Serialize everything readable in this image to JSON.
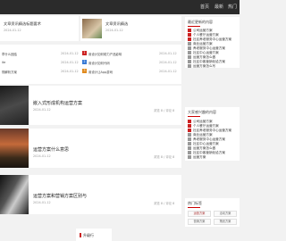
{
  "topnav": {
    "item1": "首页",
    "item2": "最新",
    "item3": "热门"
  },
  "featured": {
    "left": {
      "title": "文章资讯精选标题要术",
      "date": "2024-01-12"
    },
    "right": {
      "title": "文章资讯精选",
      "date": "2024-01-12"
    }
  },
  "small_list": {
    "col1": [
      {
        "text": "章什么团结",
        "date": "2024-01-12"
      },
      {
        "text": "ite",
        "date": "2024-01-12"
      },
      {
        "text": "规解析方案",
        "date": "2024-01-12"
      }
    ],
    "col2": [
      {
        "num": "1",
        "text": "用设计如何助力产品影响",
        "date": "2024-01-12"
      },
      {
        "num": "2",
        "text": "用设计如何代码",
        "date": "2024-01-12"
      },
      {
        "num": "3",
        "text": "用设计让App游戏",
        "date": "2024-01-12"
      }
    ]
  },
  "articles": [
    {
      "title": "嵌入式形成机构运营方案",
      "meta": "2024-01-12",
      "meta2": "浏览 8 / 评论 8"
    },
    {
      "title": "运营方案什么意思",
      "meta": "2024-01-12",
      "meta2": "浏览 8 / 评论 8"
    },
    {
      "title": "运营方案和营销方案区别与",
      "meta": "2024-01-12",
      "meta2": "浏览 8 / 评论 8"
    }
  ],
  "footer_tab": "升级行",
  "sidebar": {
    "recent_title": "最近更新的内容",
    "recent": [
      "公司运营方案",
      "个人餐厅运营方案",
      "社区养老服务中心运营方案",
      "商业运营方案",
      "养老服务中心运营方案",
      "社区中心运营方案",
      "运营方案怎么做",
      "社区中客营销化给方案",
      "运营方案怎么写"
    ],
    "popular_title": "大家感兴趣的内容",
    "popular": [
      "公司运营方案",
      "个人餐厅运营方案",
      "社区养老服务中心运营方案",
      "商业运营方案",
      "养老服务中心运营方案",
      "社区中心运营方案",
      "运营方案怎么做",
      "社区中客营销化给方案",
      "运营方案"
    ],
    "tags_title": "热门标签",
    "tags": [
      "运营方案",
      "活动方案",
      "营销方案",
      "策划方案",
      "推广方案",
      "运营规划"
    ]
  },
  "colors": {
    "accent_red": "#cc2222",
    "topbar": "#2b2b2b",
    "numbered_dots": [
      "#cc2222",
      "#3a7bd5",
      "#e08a1e"
    ]
  }
}
